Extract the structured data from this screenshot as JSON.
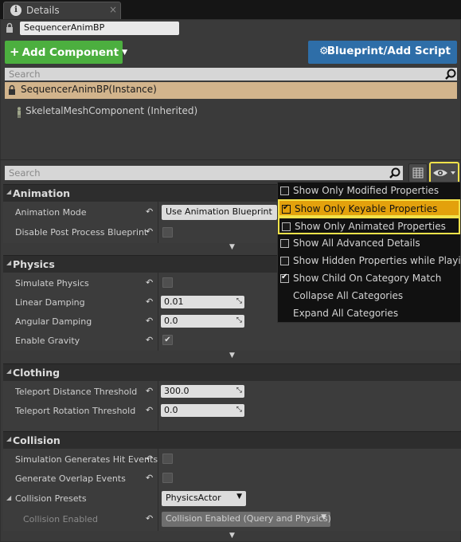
{
  "tab": {
    "title": "Details",
    "close": "×"
  },
  "name_field": {
    "value": "SequencerAnimBP"
  },
  "toolbar": {
    "add_component": "Add Component",
    "blueprint_add_script": "Blueprint/Add Script"
  },
  "component_search": {
    "placeholder": "Search"
  },
  "components": {
    "selected": "SequencerAnimBP(Instance)",
    "child": "SkeletalMeshComponent (Inherited)"
  },
  "details_search": {
    "placeholder": "Search"
  },
  "categories": {
    "animation": {
      "label": "Animation",
      "props": {
        "animation_mode": {
          "label": "Animation Mode",
          "value": "Use Animation Blueprint"
        },
        "disable_post_process": {
          "label": "Disable Post Process Blueprint",
          "checked": false
        }
      }
    },
    "physics": {
      "label": "Physics",
      "props": {
        "simulate_physics": {
          "label": "Simulate Physics",
          "checked": false
        },
        "linear_damping": {
          "label": "Linear Damping",
          "value": "0.01"
        },
        "angular_damping": {
          "label": "Angular Damping",
          "value": "0.0"
        },
        "enable_gravity": {
          "label": "Enable Gravity",
          "checked": true
        }
      }
    },
    "clothing": {
      "label": "Clothing",
      "props": {
        "teleport_distance": {
          "label": "Teleport Distance Threshold",
          "value": "300.0"
        },
        "teleport_rotation": {
          "label": "Teleport Rotation Threshold",
          "value": "0.0"
        }
      }
    },
    "collision": {
      "label": "Collision",
      "props": {
        "sim_hit_events": {
          "label": "Simulation Generates Hit Events",
          "checked": false
        },
        "overlap_events": {
          "label": "Generate Overlap Events",
          "checked": false
        },
        "collision_presets": {
          "label": "Collision Presets",
          "value": "PhysicsActor"
        },
        "collision_enabled": {
          "label": "Collision Enabled",
          "value": "Collision Enabled (Query and Physics)"
        }
      }
    }
  },
  "view_options_menu": {
    "items": [
      {
        "label": "Show Only Modified Properties",
        "checkbox": true,
        "checked": false
      },
      {
        "label": "Show Only Keyable Properties",
        "checkbox": true,
        "checked": true,
        "highlighted": true
      },
      {
        "label": "Show Only Animated Properties",
        "checkbox": true,
        "checked": false,
        "boxed": true
      },
      {
        "label": "Show All Advanced Details",
        "checkbox": true,
        "checked": false
      },
      {
        "label": "Show Hidden Properties while Playing",
        "checkbox": true,
        "checked": false
      },
      {
        "label": "Show Child On Category Match",
        "checkbox": true,
        "checked": true
      },
      {
        "label": "Collapse All Categories",
        "checkbox": false
      },
      {
        "label": "Expand All Categories",
        "checkbox": false
      }
    ]
  },
  "colors": {
    "add_component": "#4caf3f",
    "blueprint_button": "#2e6ea8",
    "selected_row": "#d2b48c",
    "menu_highlight": "#e3a10c",
    "focus_outline": "#f2e24a"
  },
  "icons": {
    "tab": "info-icon",
    "lock": "lock-icon",
    "search": "magnifier-icon",
    "blueprint": "gears-icon",
    "component": "actor-figure-icon",
    "grid": "property-matrix-icon",
    "view_options": "eye-icon",
    "reset": "arrow-reset-icon"
  }
}
